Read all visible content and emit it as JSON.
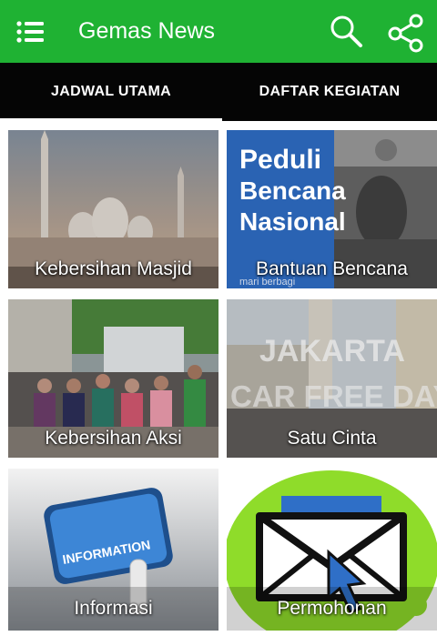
{
  "app": {
    "title": "Gemas News",
    "menu_icon": "menu-list-icon",
    "search_icon": "search-icon",
    "share_icon": "share-icon",
    "brand_color": "#1fb233"
  },
  "tabs": [
    {
      "label": "JADWAL UTAMA",
      "selected": true
    },
    {
      "label": "DAFTAR KEGIATAN",
      "selected": false
    }
  ],
  "cards": [
    {
      "label": "Kebersihan Masjid"
    },
    {
      "label": "Bantuan Bencana",
      "image_text": [
        "Peduli",
        "Bencana",
        "Nasional",
        "mari berbagi"
      ]
    },
    {
      "label": "Kebersihan Aksi"
    },
    {
      "label": "Satu Cinta",
      "image_text": [
        "JAKARTA",
        "CAR FREE DAY"
      ]
    },
    {
      "label": "Informasi",
      "image_text": [
        "INFORMATION"
      ]
    },
    {
      "label": "Permohonan"
    }
  ]
}
